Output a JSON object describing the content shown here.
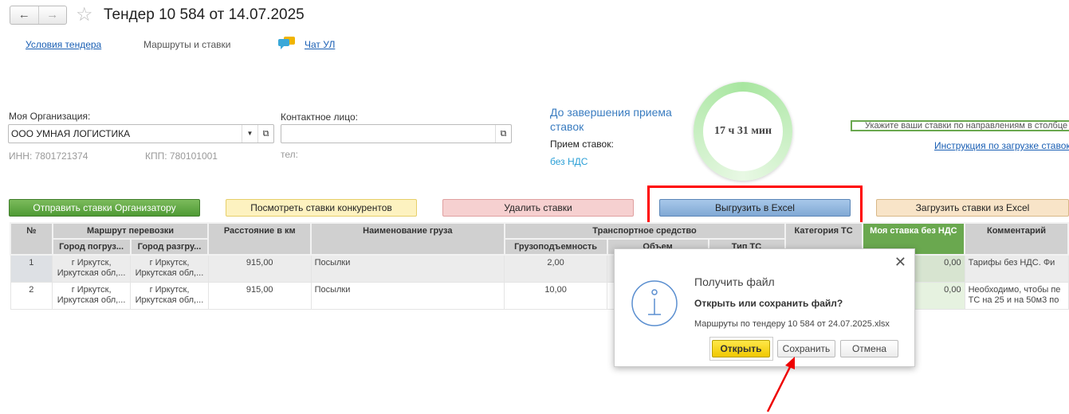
{
  "header": {
    "title": "Тендер 10 584 от 14.07.2025",
    "back_icon": "arrow-left-icon",
    "forward_icon": "arrow-right-icon",
    "star_icon": "star-icon"
  },
  "tabs": [
    {
      "label": "Условия тендера"
    },
    {
      "label": "Маршруты и ставки"
    },
    {
      "label": "Чат УЛ"
    }
  ],
  "org": {
    "label": "Моя Организация:",
    "value": "ООО УМНАЯ ЛОГИСТИКА",
    "inn": "ИНН: 7801721374",
    "kpp": "КПП: 780101001"
  },
  "contact": {
    "label": "Контактное лицо:",
    "value": "",
    "phone": "тел:"
  },
  "deadline": {
    "label": "До завершения приема ставок",
    "timer": "17 ч 31 мин",
    "accept_label": "Прием ставок:",
    "vat": "без НДС"
  },
  "hint": "Укажите ваши ставки по направлениям в столбце",
  "instruction_link": "Инструкция по загрузке ставок",
  "buttons": {
    "send": "Отправить ставки Организатору",
    "view": "Посмотреть ставки конкурентов",
    "delete": "Удалить ставки",
    "export": "Выгрузить в Excel",
    "import": "Загрузить ставки из Excel"
  },
  "table": {
    "headers": {
      "num": "№",
      "route": "Маршрут перевозки",
      "from": "Город погруз...",
      "to": "Город разгру...",
      "distance": "Расстояние в км",
      "cargo": "Наименование груза",
      "vehicle": "Транспортное средство",
      "capacity": "Грузоподъемность",
      "volume": "Объем",
      "type": "Тип ТС",
      "category": "Категория ТС",
      "rate": "Моя ставка без НДС",
      "comment": "Комментарий"
    },
    "rows": [
      {
        "num": "1",
        "from": "г Иркутск,",
        "from2": "Иркутская обл,...",
        "to": "г Иркутск,",
        "to2": "Иркутская обл,...",
        "distance": "915,00",
        "cargo": "Посылки",
        "capacity": "2,00",
        "rate": "0,00",
        "comment": "Тарифы без НДС. Фи",
        "comment2": ""
      },
      {
        "num": "2",
        "from": "г Иркутск,",
        "from2": "Иркутская обл,...",
        "to": "г Иркутск,",
        "to2": "Иркутская обл,...",
        "distance": "915,00",
        "cargo": "Посылки",
        "capacity": "10,00",
        "rate": "0,00",
        "comment": "Необходимо, чтобы пе",
        "comment2": "ТС на 25 и на 50м3 по"
      }
    ]
  },
  "dialog": {
    "title": "Получить файл",
    "question": "Открыть или сохранить файл?",
    "filename": "Маршруты по тендеру 10 584 от 24.07.2025.xlsx",
    "open": "Открыть",
    "save": "Сохранить",
    "cancel": "Отмена",
    "icon": "info-icon"
  },
  "colors": {
    "accent_green": "#6aa84f",
    "highlight_red": "#ff0000",
    "export_blue": "#8fb8e0",
    "open_yellow": "#f5d000"
  }
}
